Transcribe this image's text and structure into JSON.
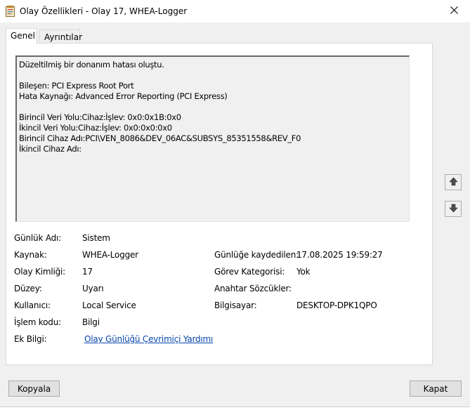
{
  "window": {
    "title": "Olay Özellikleri - Olay 17, WHEA-Logger",
    "colors": {
      "link": "#0645ad",
      "background": "#f0f0f0"
    }
  },
  "tabs": [
    {
      "label": "Genel",
      "active": true
    },
    {
      "label": "Ayrıntılar",
      "active": false
    }
  ],
  "description": "Düzeltilmiş bir donanım hatası oluştu.\n\nBileşen: PCI Express Root Port\nHata Kaynağı: Advanced Error Reporting (PCI Express)\n\nBirincil Veri Yolu:Cihaz:İşlev: 0x0:0x1B:0x0\nİkincil Veri Yolu:Cihaz:İşlev: 0x0:0x0:0x0\nBirincil Cihaz Adı:PCI\\VEN_8086&DEV_06AC&SUBSYS_85351558&REV_F0\nİkincil Cihaz Adı:",
  "fields": {
    "log_name": {
      "label": "Günlük Adı:",
      "value": "Sistem"
    },
    "source": {
      "label": "Kaynak:",
      "value": "WHEA-Logger"
    },
    "logged": {
      "label": "Günlüğe kaydedilen:",
      "value": "17.08.2025 19:59:27"
    },
    "event_id": {
      "label": "Olay Kimliği:",
      "value": "17"
    },
    "task_category": {
      "label": "Görev Kategorisi:",
      "value": "Yok"
    },
    "level": {
      "label": "Düzey:",
      "value": "Uyarı"
    },
    "keywords": {
      "label": "Anahtar Sözcükler:",
      "value": ""
    },
    "user": {
      "label": "Kullanıcı:",
      "value": "Local Service"
    },
    "computer": {
      "label": "Bilgisayar:",
      "value": "DESKTOP-DPK1QPO"
    },
    "opcode": {
      "label": "İşlem kodu:",
      "value": "Bilgi"
    },
    "more_info": {
      "label": "Ek Bilgi:",
      "link": "Olay Günlüğü Çevrimiçi Yardımı"
    }
  },
  "buttons": {
    "copy": "Kopyala",
    "close": "Kapat"
  },
  "icons": {
    "window": "event-viewer-icon",
    "close": "close-icon",
    "up": "arrow-up-icon",
    "down": "arrow-down-icon"
  }
}
